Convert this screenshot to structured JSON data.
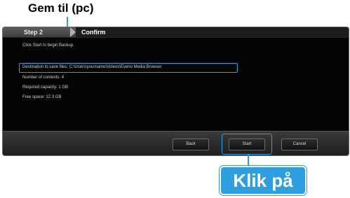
{
  "annotations": {
    "top_label": "Gem til (pc)",
    "bottom_label": "Klik på",
    "highlight_color": "#2d9fe0"
  },
  "wizard": {
    "steps": [
      {
        "label": "Step 2",
        "active": false
      },
      {
        "label": "Confirm",
        "active": true
      }
    ],
    "content": {
      "instruction": "Click Start to begin Backup.",
      "destination": "Destination to save files: C:\\Users\\yourname\\Videos\\Everio Media Browser",
      "file_count": "Number of contents: 4",
      "file_size": "Required capacity: 1 GB",
      "free_space": "Free space: 12.3 GB"
    },
    "buttons": {
      "back": "Back",
      "start": "Start",
      "cancel": "Cancel"
    }
  }
}
